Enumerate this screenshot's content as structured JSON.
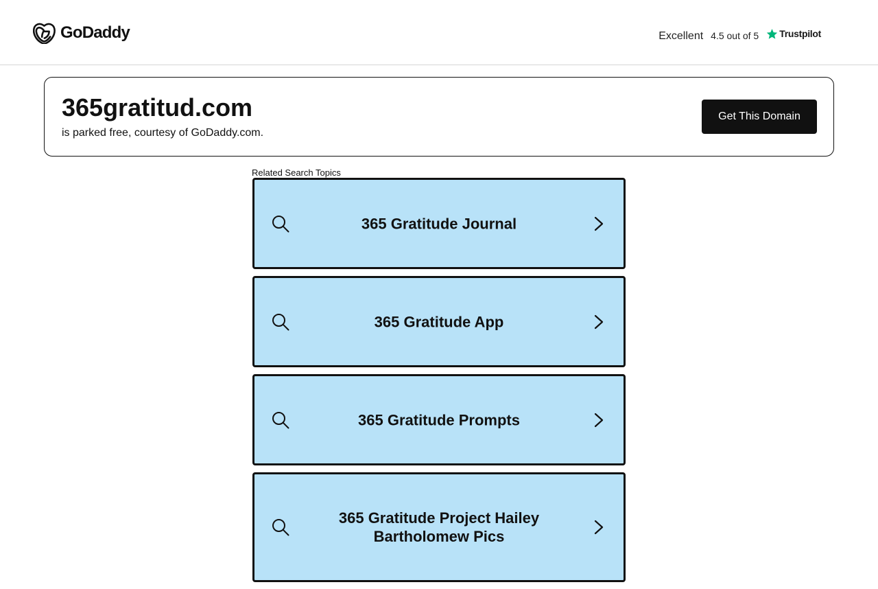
{
  "header": {
    "logo_text": "GoDaddy",
    "trustpilot": {
      "rating_word": "Excellent",
      "score_text": "4.5 out of 5",
      "brand": "Trustpilot",
      "star_color": "#00b67a"
    }
  },
  "domain": {
    "name": "365gratitud.com",
    "subtitle": "is parked free, courtesy of GoDaddy.com.",
    "cta_label": "Get This Domain"
  },
  "related": {
    "label": "Related Search Topics",
    "background_color": "#b8e2f8",
    "items": [
      {
        "label": "365 Gratitude Journal",
        "icon": "search-icon",
        "arrow": "chevron-right-icon"
      },
      {
        "label": "365 Gratitude App",
        "icon": "search-icon",
        "arrow": "chevron-right-icon"
      },
      {
        "label": "365 Gratitude Prompts",
        "icon": "search-icon",
        "arrow": "chevron-right-icon"
      },
      {
        "label": "365 Gratitude Project Hailey Bartholomew Pics",
        "icon": "search-icon",
        "arrow": "chevron-right-icon"
      }
    ]
  }
}
